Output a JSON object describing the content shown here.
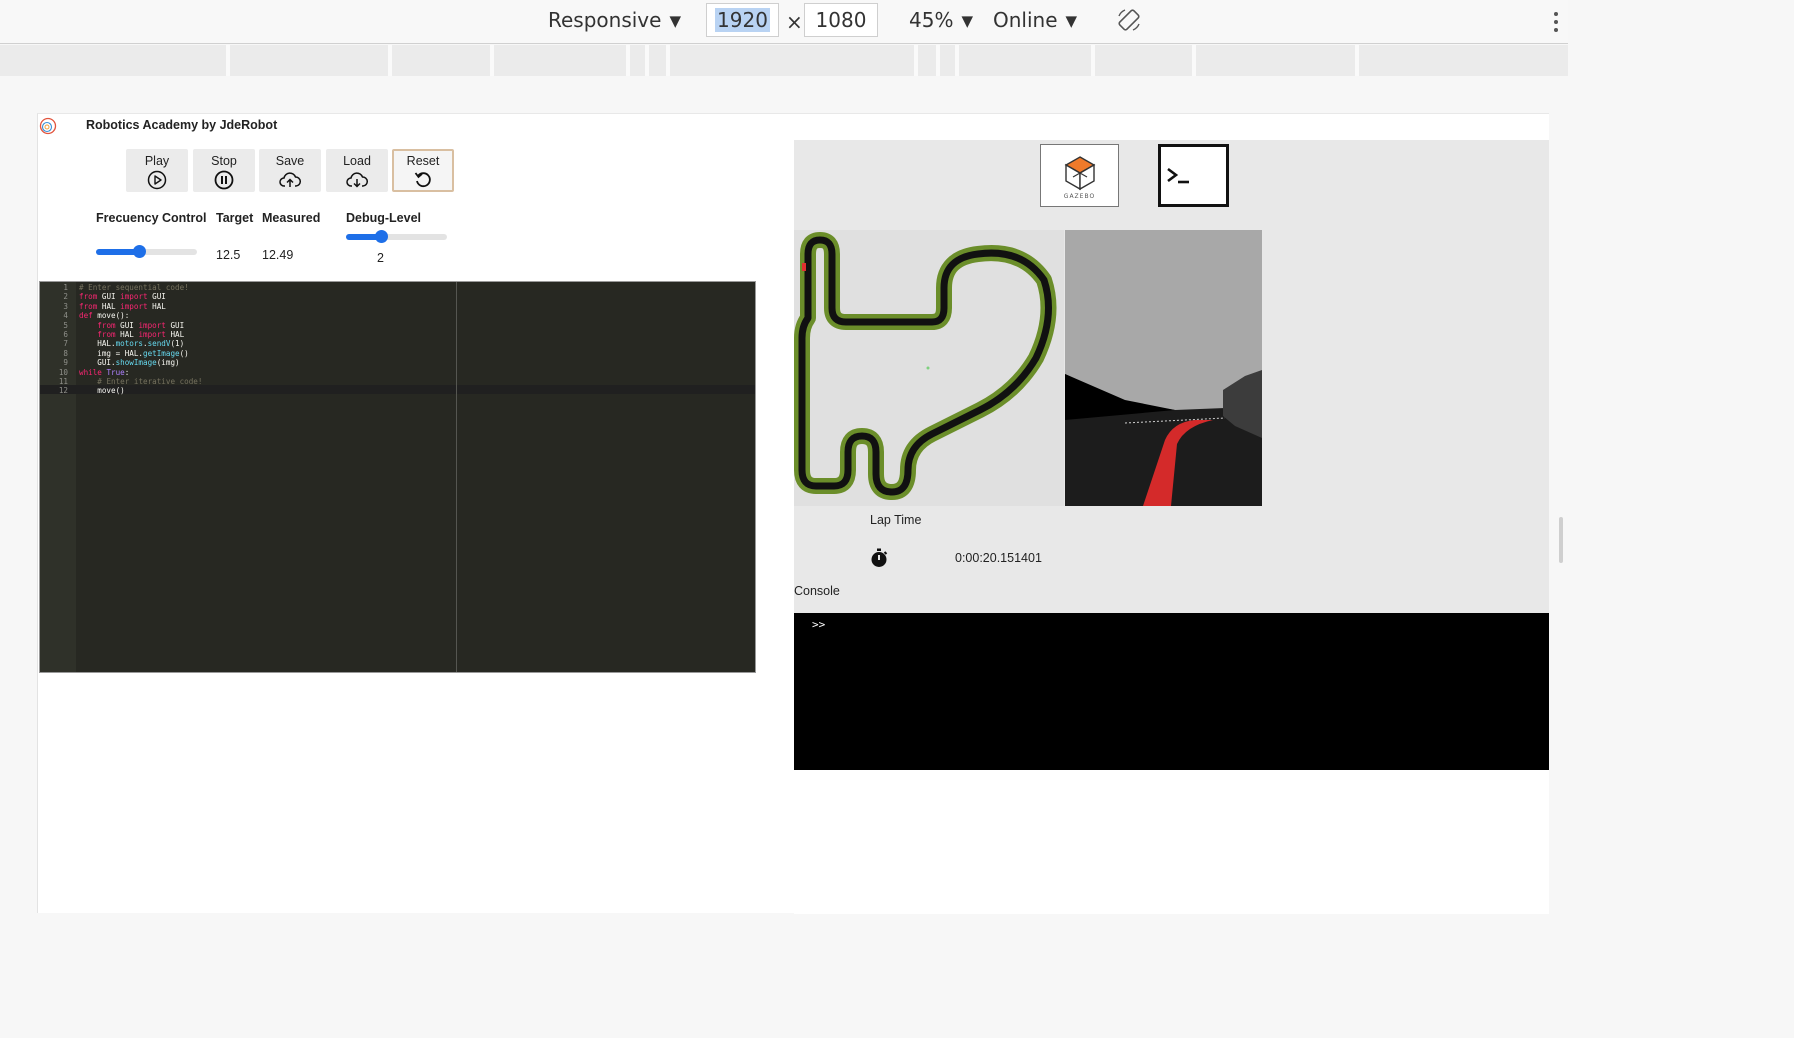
{
  "devtools": {
    "device": "Responsive",
    "width": "1920",
    "height": "1080",
    "times": "×",
    "zoom": "45%",
    "network": "Online",
    "caret": "▼"
  },
  "app": {
    "title": "Robotics Academy by JdeRobot"
  },
  "controls": {
    "play": "Play",
    "stop": "Stop",
    "save": "Save",
    "load": "Load",
    "reset": "Reset"
  },
  "frequency": {
    "label": "Frecuency Control",
    "target_label": "Target",
    "measured_label": "Measured",
    "target_value": "12.5",
    "measured_value": "12.49",
    "slider_fraction": 0.43
  },
  "debug": {
    "label": "Debug-Level",
    "value": "2",
    "slider_fraction": 0.35
  },
  "editor": {
    "line_numbers": [
      "1",
      "2",
      "3",
      "4",
      "5",
      "6",
      "7",
      "8",
      "9",
      "10",
      "11",
      "12"
    ],
    "lines": [
      [
        {
          "t": "# Enter sequential code!",
          "c": "c"
        }
      ],
      [
        {
          "t": "from",
          "c": "k"
        },
        {
          "t": " GUI "
        },
        {
          "t": "import",
          "c": "k"
        },
        {
          "t": " GUI"
        }
      ],
      [
        {
          "t": "from",
          "c": "k"
        },
        {
          "t": " HAL "
        },
        {
          "t": "import",
          "c": "k"
        },
        {
          "t": " HAL"
        }
      ],
      [
        {
          "t": "def",
          "c": "k"
        },
        {
          "t": " move():"
        }
      ],
      [
        {
          "t": "    "
        },
        {
          "t": "from",
          "c": "k"
        },
        {
          "t": " GUI "
        },
        {
          "t": "import",
          "c": "k"
        },
        {
          "t": " GUI"
        }
      ],
      [
        {
          "t": "    "
        },
        {
          "t": "from",
          "c": "k"
        },
        {
          "t": " HAL "
        },
        {
          "t": "import",
          "c": "k"
        },
        {
          "t": " HAL"
        }
      ],
      [
        {
          "t": "    HAL."
        },
        {
          "t": "motors",
          "c": "f"
        },
        {
          "t": "."
        },
        {
          "t": "sendV",
          "c": "f"
        },
        {
          "t": "(1)"
        }
      ],
      [
        {
          "t": "    img = HAL."
        },
        {
          "t": "getImage",
          "c": "f"
        },
        {
          "t": "()"
        }
      ],
      [
        {
          "t": "    GUI."
        },
        {
          "t": "showImage",
          "c": "f"
        },
        {
          "t": "(img)"
        }
      ],
      [
        {
          "t": "while",
          "c": "k"
        },
        {
          "t": " "
        },
        {
          "t": "True",
          "c": "b"
        },
        {
          "t": ":"
        }
      ],
      [
        {
          "t": "    "
        },
        {
          "t": "# Enter iterative code!",
          "c": "c"
        }
      ],
      [
        {
          "t": "    move()"
        }
      ]
    ]
  },
  "gazebo": {
    "label": "GAZEBO"
  },
  "lap": {
    "label": "Lap Time",
    "time": "0:00:20.151401"
  },
  "console": {
    "label": "Console",
    "prompt": ">>"
  },
  "colors": {
    "accent": "#1e6fe8",
    "editor_bg": "#272822",
    "track_green": "#6b8e2a",
    "gazebo_orange": "#f07a2a"
  }
}
